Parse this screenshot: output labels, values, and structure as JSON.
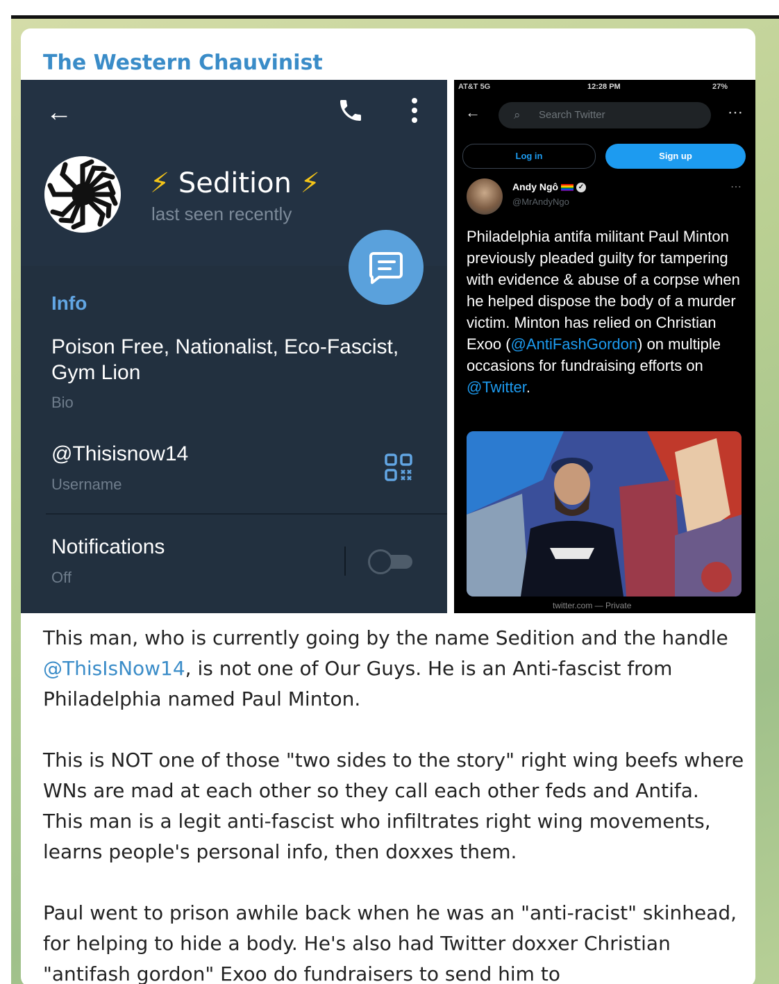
{
  "channel": {
    "name": "The Western Chauvinist"
  },
  "telegram_profile": {
    "name": "Sedition",
    "bolt": "⚡",
    "last_seen": "last seen recently",
    "info_label": "Info",
    "bio": "Poison Free, Nationalist, Eco-Fascist, Gym Lion",
    "bio_label": "Bio",
    "username": "@Thisisnow14",
    "username_label": "Username",
    "notifications_label": "Notifications",
    "notifications_value": "Off"
  },
  "twitter": {
    "status": {
      "carrier": "AT&T 5G",
      "time": "12:28 PM",
      "battery": "27%"
    },
    "search_placeholder": "Search Twitter",
    "login": "Log in",
    "signup": "Sign up",
    "author_name": "Andy Ngô",
    "author_handle": "@MrAndyNgo",
    "tweet_before_link1": "Philadelphia antifa militant Paul Minton previously pleaded guilty for tampering with evidence & abuse of a corpse when he helped dispose the body of a murder victim. Minton has relied on Christian Exoo (",
    "tweet_link1": "@AntiFashGordon",
    "tweet_between": ") on multiple occasions for fundraising efforts on ",
    "tweet_link2": "@Twitter",
    "tweet_end": ".",
    "footer": "twitter.com — Private"
  },
  "caption": {
    "p1_a": "This man, who is currently going by the name Sedition and the handle ",
    "p1_mention": "@ThisIsNow14",
    "p1_b": ", is not one of Our Guys.  He is an Anti-fascist from Philadelphia named Paul Minton.",
    "p2": "This is NOT one of those \"two sides to the story\" right wing beefs where WNs are mad at each other so they call each other feds and Antifa.  This man is a legit anti-fascist who infiltrates right wing movements, learns people's personal info, then doxxes them.",
    "p3": "Paul went to prison awhile back when he was an \"anti-racist\" skinhead, for helping to hide a body.  He's also had Twitter doxxer Christian \"antifash gordon\" Exoo do fundraisers to send him to"
  },
  "colors": {
    "channel_blue": "#3a8cc8",
    "telegram_bg": "#22303f",
    "telegram_accent": "#62a6e4",
    "twitter_blue": "#1d9bf0"
  }
}
